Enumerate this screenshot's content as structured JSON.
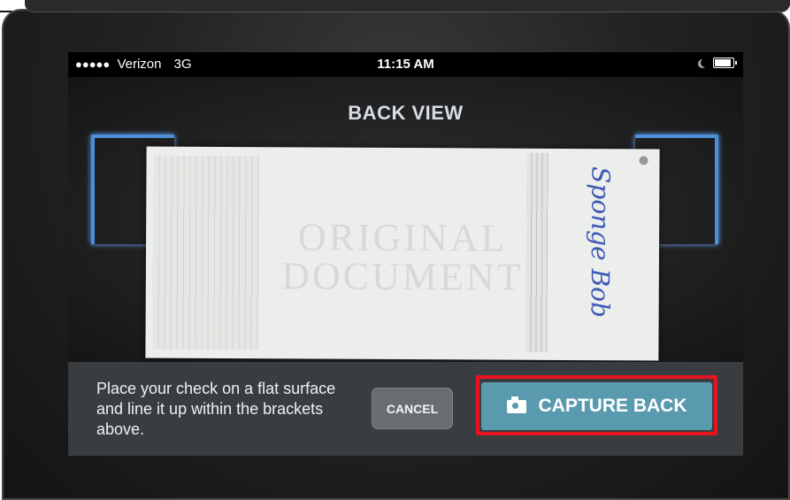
{
  "status_bar": {
    "signal": "●●●●●",
    "carrier": "Verizon",
    "network": "3G",
    "time": "11:15 AM"
  },
  "camera": {
    "title": "BACK VIEW",
    "check_watermark_line1": "ORIGINAL",
    "check_watermark_line2": "DOCUMENT",
    "signature": "Sponge Bob"
  },
  "action_bar": {
    "instructions": "Place your check on a flat surface and line it up within the brackets above.",
    "cancel_label": "CANCEL",
    "capture_label": "CAPTURE BACK"
  },
  "colors": {
    "bracket": "#4a8fd8",
    "capture_button": "#5a9aae",
    "highlight_border": "#e5141e"
  },
  "icons": [
    "moon-icon",
    "battery-icon",
    "camera-icon"
  ]
}
